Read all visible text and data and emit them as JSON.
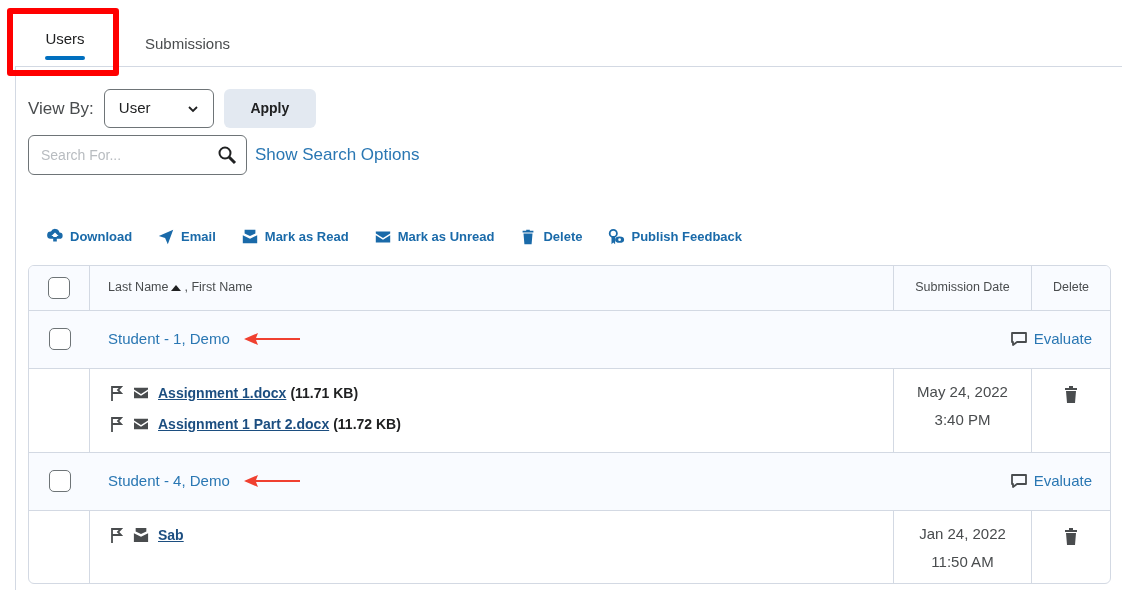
{
  "tabs": [
    {
      "label": "Users",
      "selected": true,
      "highlighted": true
    },
    {
      "label": "Submissions",
      "selected": false,
      "highlighted": false
    }
  ],
  "view_by": {
    "label": "View By:",
    "value": "User",
    "apply": "Apply"
  },
  "search": {
    "placeholder": "Search For...",
    "options_link": "Show Search Options"
  },
  "toolbar": [
    {
      "kind": "download",
      "label": "Download"
    },
    {
      "kind": "email",
      "label": "Email"
    },
    {
      "kind": "read",
      "label": "Mark as Read"
    },
    {
      "kind": "unread",
      "label": "Mark as Unread"
    },
    {
      "kind": "delete",
      "label": "Delete"
    },
    {
      "kind": "publish",
      "label": "Publish Feedback"
    }
  ],
  "table": {
    "columns": [
      "Last Name",
      ", First Name",
      "Submission Date",
      "Delete"
    ],
    "all_checked": false,
    "users": [
      {
        "name": "Student - 1, Demo",
        "checked": false,
        "pointed": true,
        "evaluate": "Evaluate",
        "date": "May 24, 2022",
        "time": "3:40 PM",
        "files": [
          {
            "name": "Assignment 1.docx",
            "size": "(11.71 KB)",
            "read": false
          },
          {
            "name": "Assignment 1 Part 2.docx",
            "size": "(11.72 KB)",
            "read": false
          }
        ]
      },
      {
        "name": "Student - 4, Demo",
        "checked": false,
        "pointed": true,
        "evaluate": "Evaluate",
        "date": "Jan 24, 2022",
        "time": "11:50 AM",
        "files": [
          {
            "name": "Sab",
            "read": true
          }
        ]
      }
    ]
  }
}
